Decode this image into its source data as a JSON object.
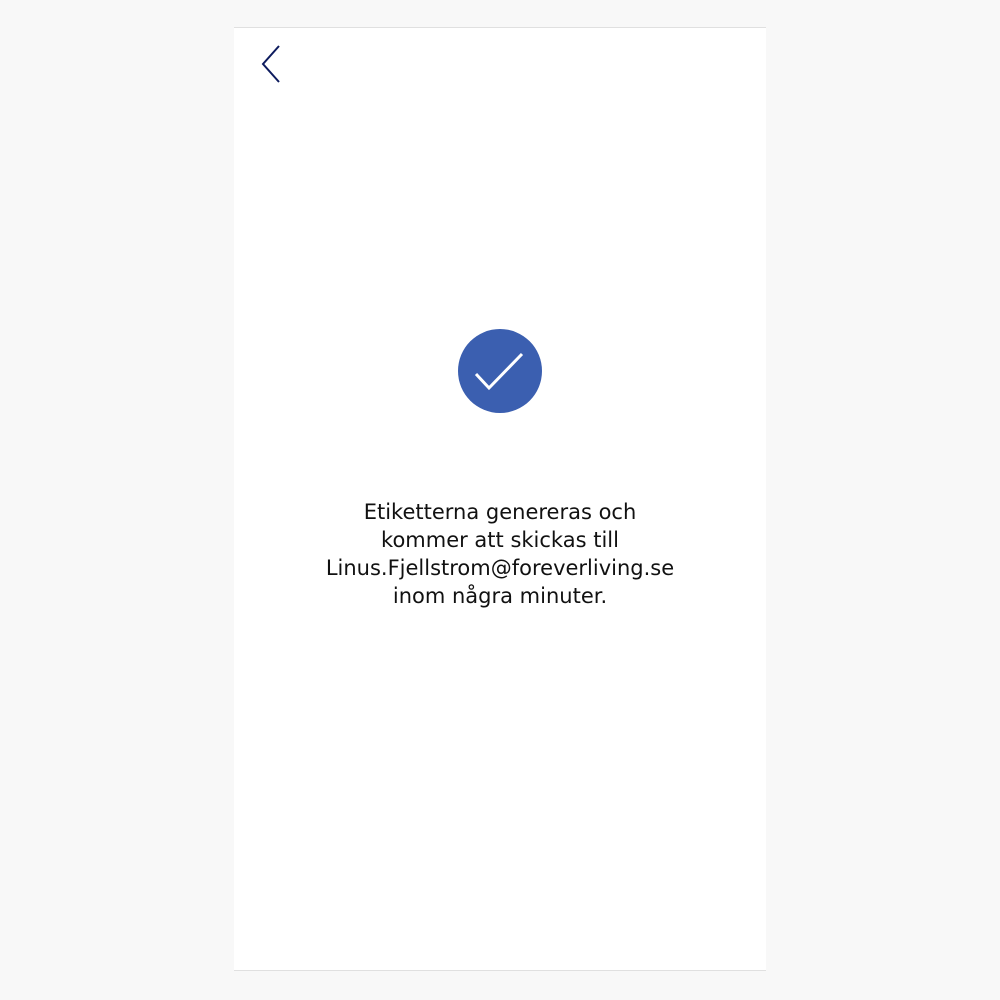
{
  "colors": {
    "accent": "#3b5fb0",
    "back_icon": "#0d1b5e",
    "check_icon": "#ffffff",
    "text": "#111111"
  },
  "icons": {
    "back": "chevron-left-icon",
    "success": "checkmark-circle-icon"
  },
  "confirmation": {
    "line_1": "Etiketterna genereras och",
    "line_2": "kommer att skickas till",
    "line_3": "Linus.Fjellstrom@foreverliving.se",
    "line_4": "inom några minuter."
  }
}
